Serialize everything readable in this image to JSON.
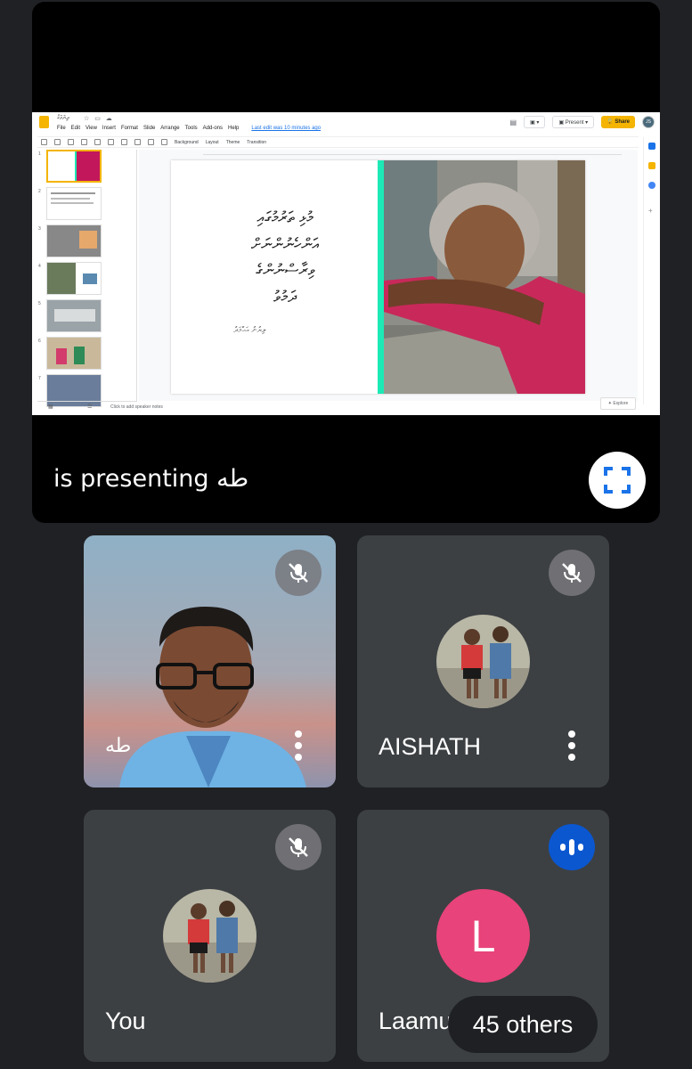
{
  "presentation": {
    "presenter_caption": "is presenting طه",
    "app": {
      "doc_title": "ދިޔަމަގު",
      "menu": [
        "File",
        "Edit",
        "View",
        "Insert",
        "Format",
        "Slide",
        "Arrange",
        "Tools",
        "Add-ons",
        "Help"
      ],
      "last_edit": "Last edit was 10 minutes ago",
      "present_label": "Present",
      "share_label": "Share",
      "toolbar": {
        "background": "Background",
        "layout": "Layout",
        "theme": "Theme",
        "transition": "Transition"
      },
      "slide_numbers": [
        "1",
        "2",
        "3",
        "4",
        "5",
        "6",
        "7"
      ],
      "notes_placeholder": "Click to add speaker notes",
      "explore_label": "Explore",
      "slide": {
        "text_lines": [
          "މުޅި ތަރުމުގައި",
          "އަންހެނުންނަށް",
          "ވިރާސްނުންގެ",
          "ދަމުވު"
        ],
        "author": "ލިޔުނު އަޙްމަދު"
      }
    }
  },
  "participants": [
    {
      "name": "طه",
      "mic": "muted",
      "avatar": "video"
    },
    {
      "name": "AISHATH",
      "mic": "muted",
      "avatar": "photo"
    },
    {
      "name": "You",
      "mic": "muted",
      "avatar": "photo"
    },
    {
      "name": "Laamu A",
      "mic": "speaking",
      "avatar": "letter",
      "letter": "L",
      "color": "#e8437a"
    }
  ],
  "others_label": "45 others",
  "colors": {
    "background": "#202124",
    "tile": "#3c4043",
    "speaking": "#0b57d0",
    "accent": "#1de9b6"
  }
}
